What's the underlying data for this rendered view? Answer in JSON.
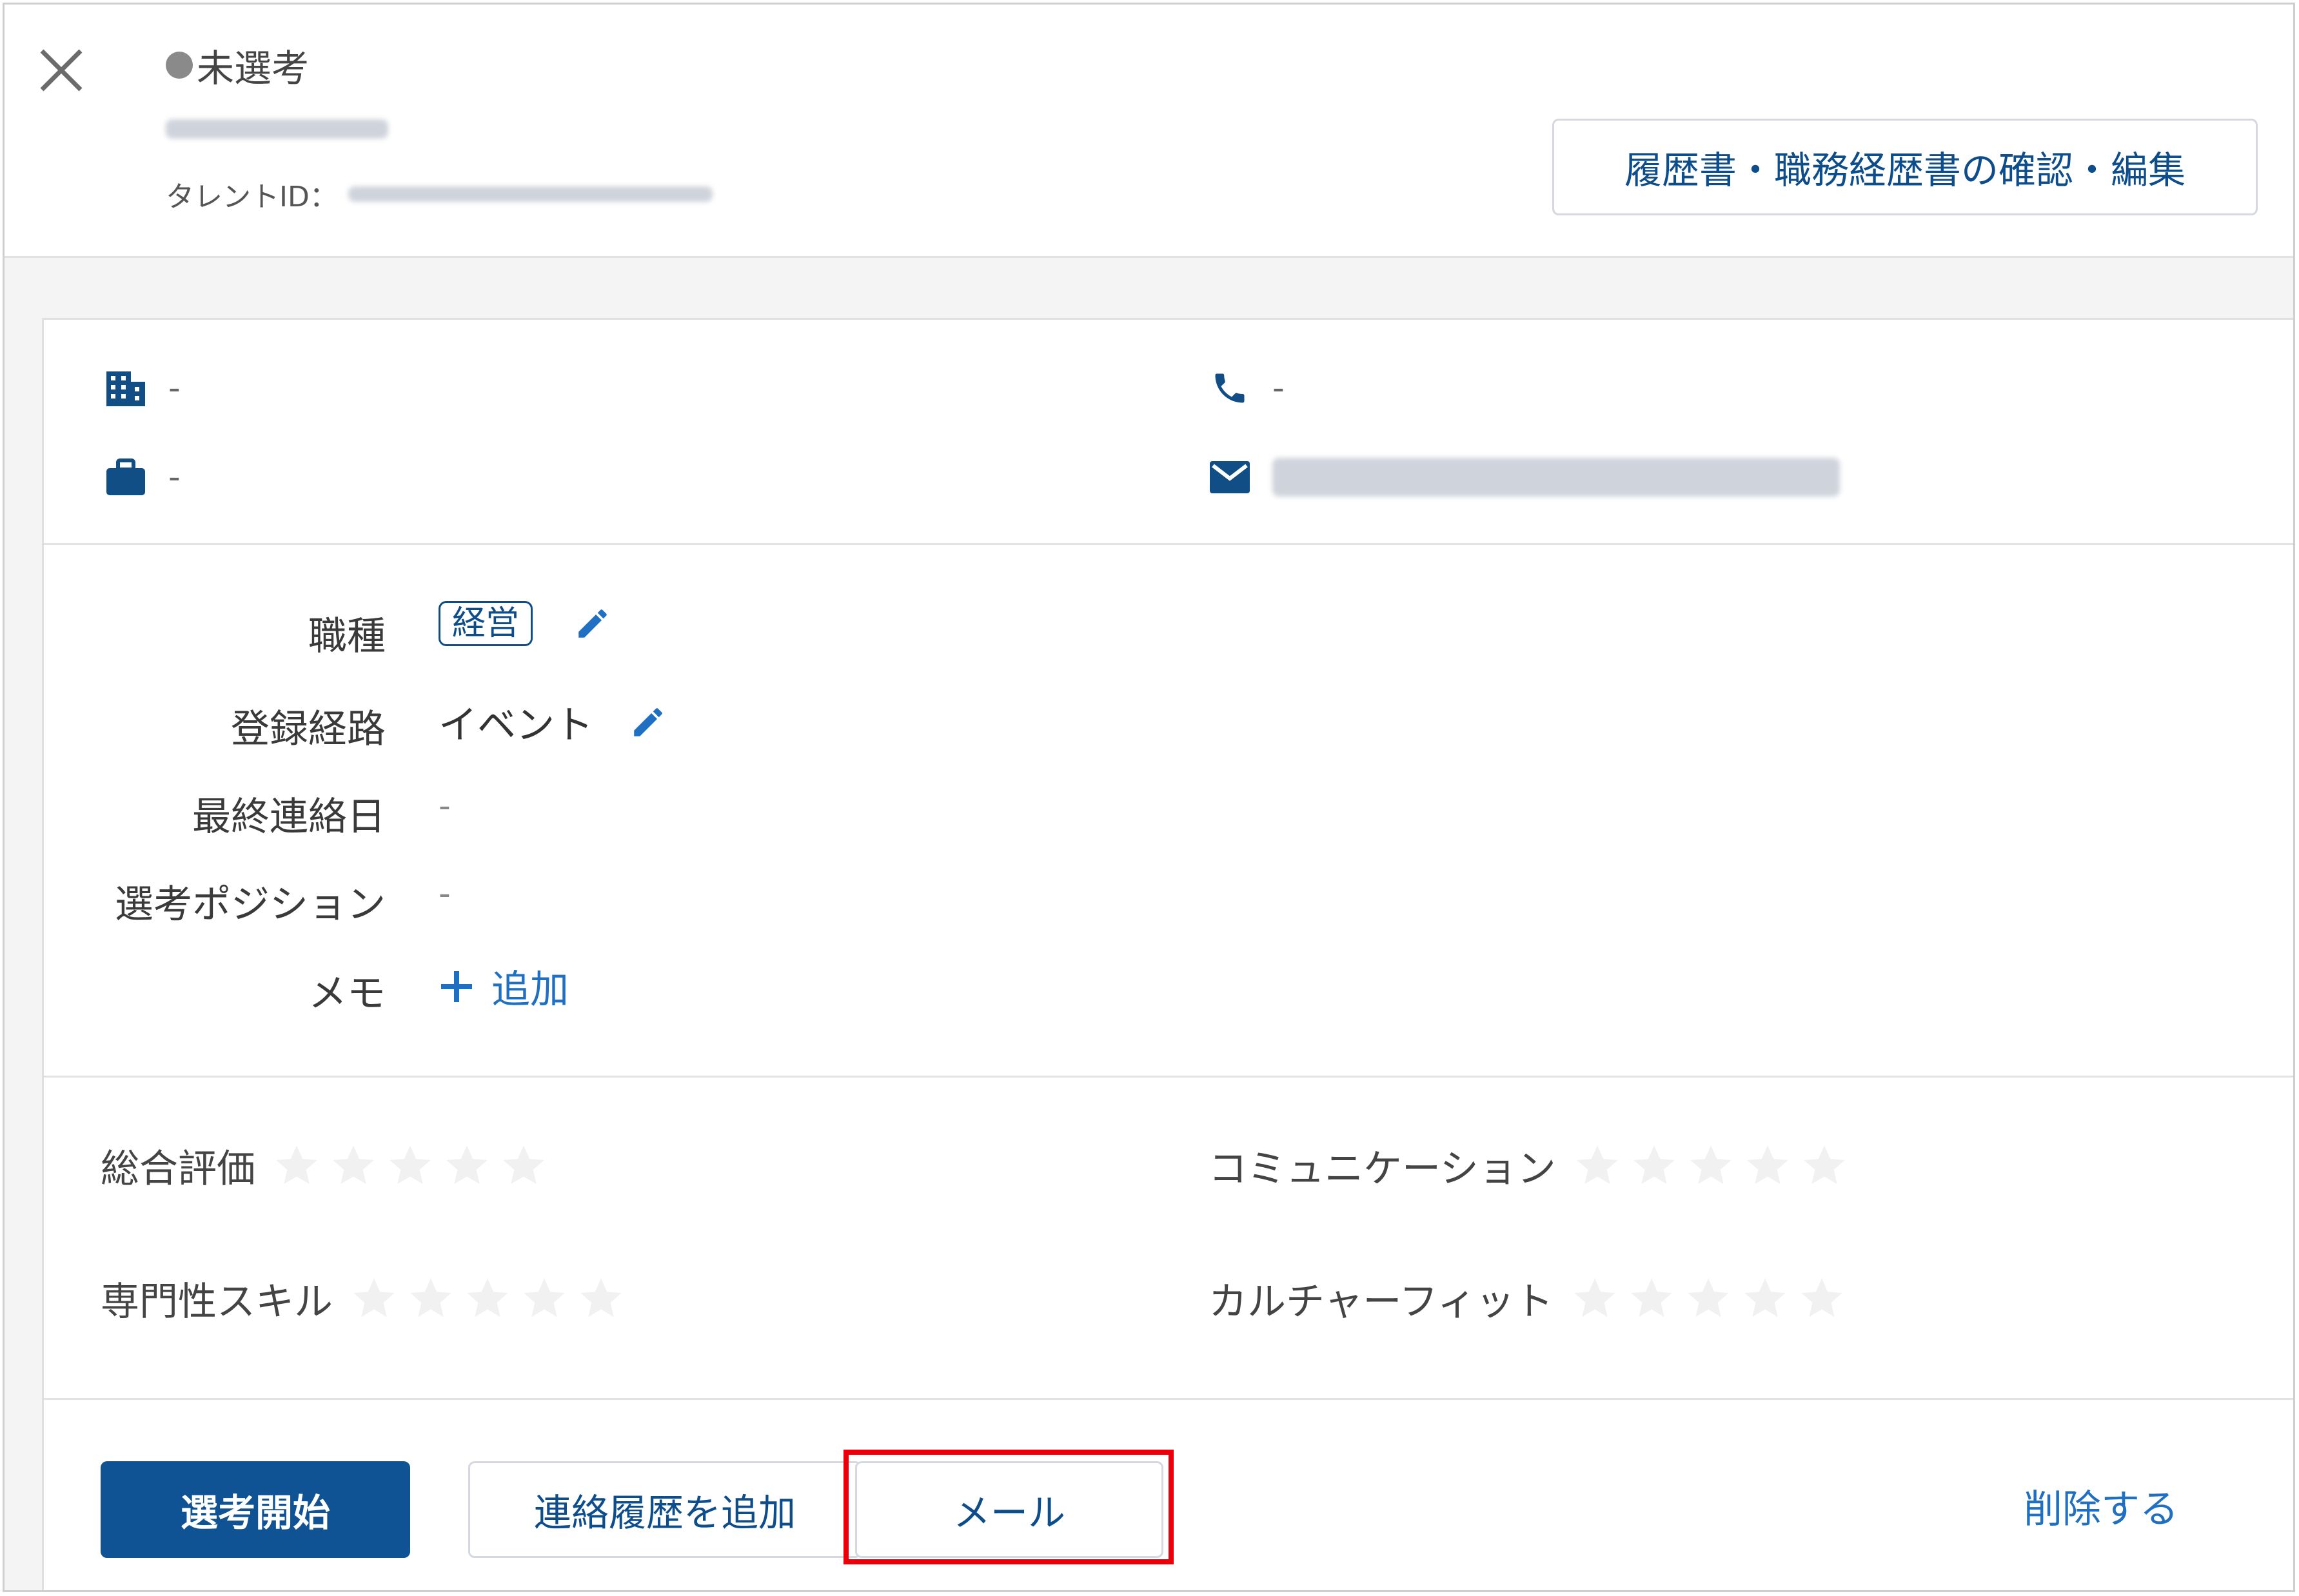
{
  "header": {
    "status_label": "未選考",
    "talent_id_label": "タレントID：",
    "resume_button_label": "履歴書・職務経歴書の確認・編集"
  },
  "contact": {
    "company": "-",
    "position": "-",
    "phone": "-"
  },
  "fields": {
    "job_type": {
      "label": "職種",
      "tag": "経営"
    },
    "registration_route": {
      "label": "登録経路",
      "value": "イベント"
    },
    "last_contact_date": {
      "label": "最終連絡日",
      "value": "-"
    },
    "selection_position": {
      "label": "選考ポジション",
      "value": "-"
    },
    "memo": {
      "label": "メモ",
      "add_label": "追加"
    }
  },
  "ratings": [
    {
      "label": "総合評価",
      "stars": 0,
      "max": 5
    },
    {
      "label": "コミュニケーション",
      "stars": 0,
      "max": 5
    },
    {
      "label": "専門性スキル",
      "stars": 0,
      "max": 5
    },
    {
      "label": "カルチャーフィット",
      "stars": 0,
      "max": 5
    }
  ],
  "actions": {
    "start_selection": "選考開始",
    "add_contact_history": "連絡履歴を追加",
    "mail": "メール",
    "delete": "削除する"
  },
  "colors": {
    "primary": "#0f5394",
    "link": "#1f6fc2",
    "highlight": "#e8000b",
    "star_empty": "#f1f1f1"
  },
  "icons": [
    "close-icon",
    "building-icon",
    "briefcase-icon",
    "phone-icon",
    "mail-icon",
    "pencil-icon",
    "plus-icon",
    "star-icon"
  ]
}
